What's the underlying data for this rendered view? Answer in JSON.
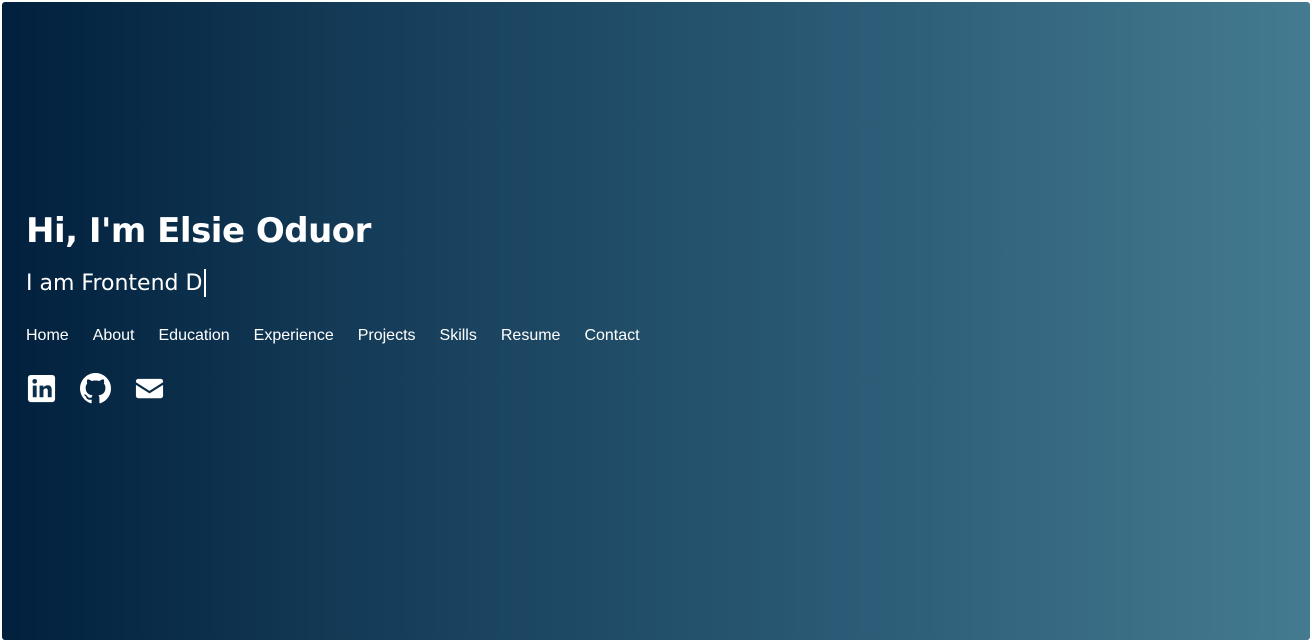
{
  "hero": {
    "headline": "Hi, I'm Elsie Oduor",
    "typed_text": "I am Frontend D"
  },
  "nav": {
    "items": [
      {
        "label": "Home"
      },
      {
        "label": "About"
      },
      {
        "label": "Education"
      },
      {
        "label": "Experience"
      },
      {
        "label": "Projects"
      },
      {
        "label": "Skills"
      },
      {
        "label": "Resume"
      },
      {
        "label": "Contact"
      }
    ]
  },
  "socials": {
    "icons": [
      "linkedin-icon",
      "github-icon",
      "envelope-icon"
    ]
  },
  "colors": {
    "gradient_start": "#01203d",
    "gradient_end": "#447b90",
    "text": "#ffffff"
  }
}
